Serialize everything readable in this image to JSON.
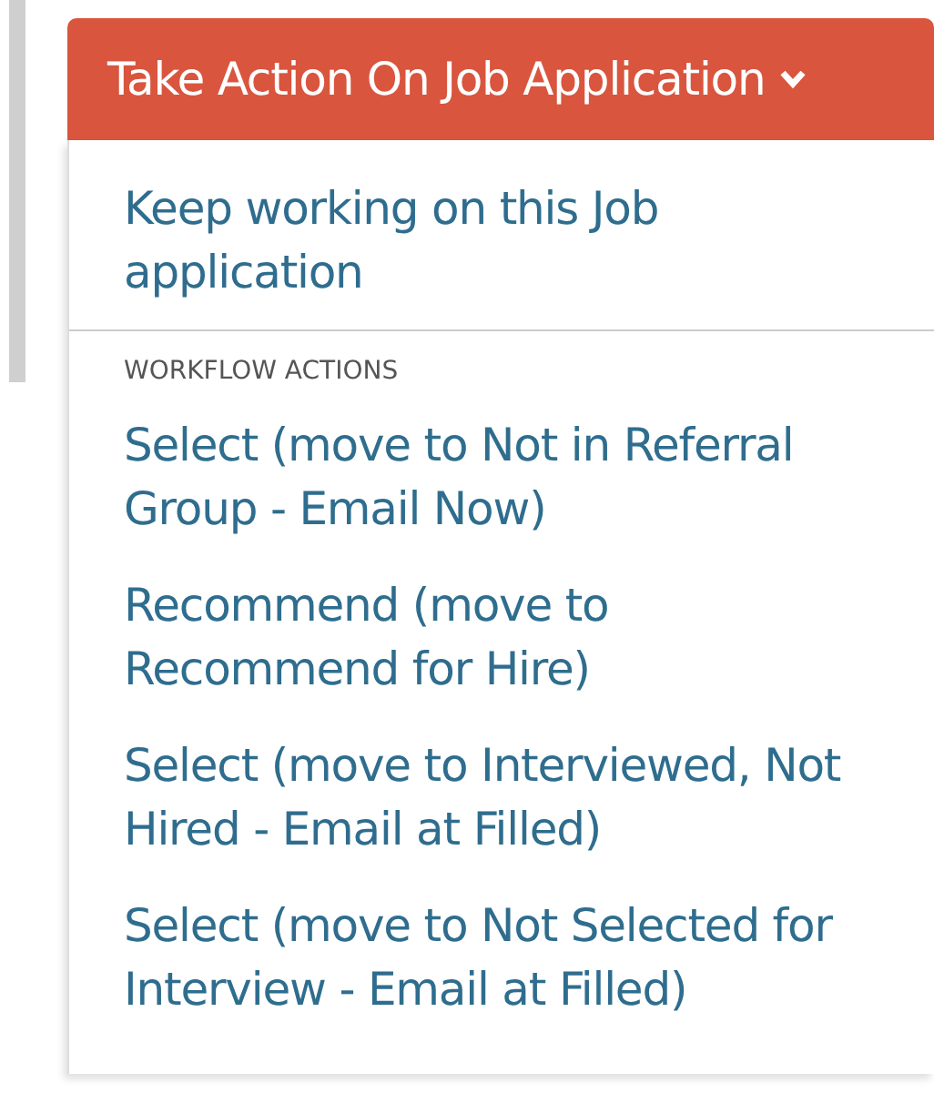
{
  "menu_button": {
    "label": "Take Action On Job Application",
    "expanded": true
  },
  "menu_items": [
    {
      "kind": "action",
      "label": "Keep working on this Job application"
    },
    {
      "kind": "divider"
    },
    {
      "kind": "section-header",
      "label": "WORKFLOW ACTIONS"
    },
    {
      "kind": "action",
      "label": "Select (move to Not in Referral Group - Email Now)"
    },
    {
      "kind": "action",
      "label": "Recommend (move to Recommend for Hire)"
    },
    {
      "kind": "action",
      "label": "Select (move to Interviewed, Not Hired - Email at Filled)"
    },
    {
      "kind": "action",
      "label": "Select (move to Not Selected for Interview - Email at Filled)"
    }
  ]
}
